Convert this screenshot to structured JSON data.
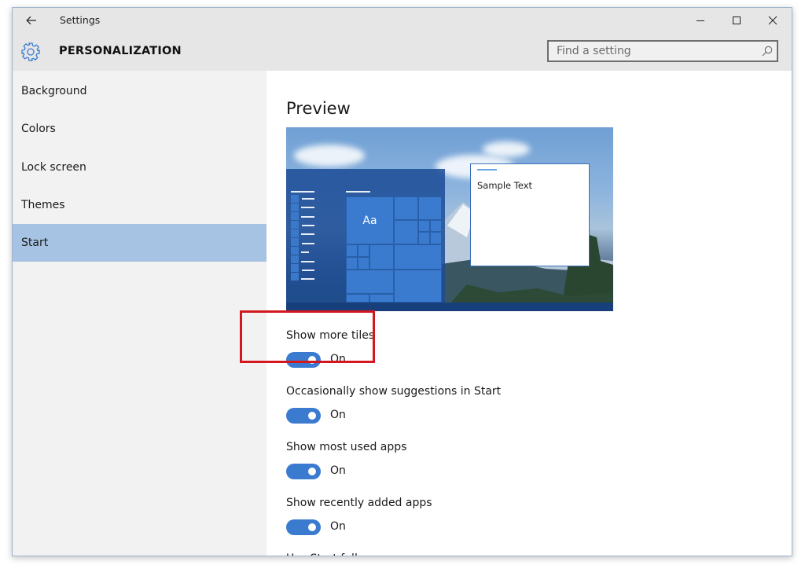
{
  "window": {
    "title": "Settings",
    "controls": {
      "minimize": "minimize",
      "maximize": "maximize",
      "close": "close"
    }
  },
  "header": {
    "icon": "gear-icon",
    "title": "PERSONALIZATION",
    "search": {
      "placeholder": "Find a setting",
      "value": "",
      "icon": "search-icon"
    }
  },
  "sidebar": {
    "items": [
      {
        "label": "Background",
        "selected": false
      },
      {
        "label": "Colors",
        "selected": false
      },
      {
        "label": "Lock screen",
        "selected": false
      },
      {
        "label": "Themes",
        "selected": false
      },
      {
        "label": "Start",
        "selected": true
      }
    ]
  },
  "main": {
    "preview_title": "Preview",
    "preview": {
      "tile_text": "Aa",
      "sample_text": "Sample Text"
    },
    "settings": [
      {
        "label": "Show more tiles",
        "state": "On",
        "enabled": true,
        "highlighted": true
      },
      {
        "label": "Occasionally show suggestions in Start",
        "state": "On",
        "enabled": true
      },
      {
        "label": "Show most used apps",
        "state": "On",
        "enabled": true
      },
      {
        "label": "Show recently added apps",
        "state": "On",
        "enabled": true
      },
      {
        "label": "Use Start full screen"
      }
    ]
  },
  "colors": {
    "accent": "#3a7bd0",
    "selected_nav": "#a6c3e3",
    "highlight_box": "#d4161f"
  }
}
